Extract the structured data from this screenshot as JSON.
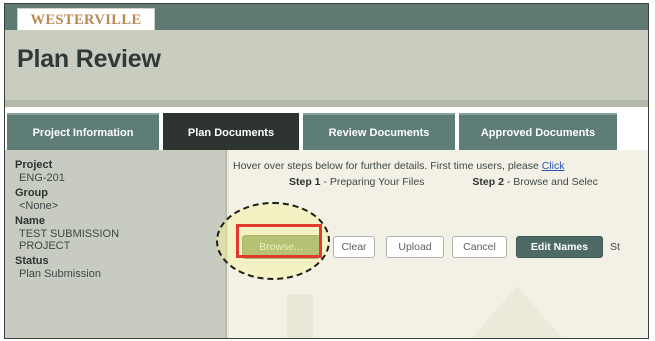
{
  "app": {
    "logo_text": "WESTERVILLE",
    "page_title": "Plan Review"
  },
  "tabs": [
    {
      "label": "Project Information",
      "active": false
    },
    {
      "label": "Plan Documents",
      "active": true
    },
    {
      "label": "Review Documents",
      "active": false
    },
    {
      "label": "Approved Documents",
      "active": false
    }
  ],
  "sidebar": {
    "fields": [
      {
        "label": "Project",
        "value": "ENG-201"
      },
      {
        "label": "Group",
        "value": "<None>"
      },
      {
        "label": "Name",
        "value": "TEST SUBMISSION PROJECT"
      },
      {
        "label": "Status",
        "value": "Plan Submission"
      }
    ]
  },
  "main": {
    "hint_text": "Hover over steps below for further details. First time users, please ",
    "hint_link": "Click",
    "step1_label": "Step 1",
    "step1_text": " - Preparing Your Files",
    "step2_label": "Step 2",
    "step2_text": " - Browse and Selec",
    "trailing_text": "St"
  },
  "toolbar": {
    "browse_label": "Browse...",
    "clear_label": "Clear",
    "upload_label": "Upload",
    "cancel_label": "Cancel",
    "edit_names_label": "Edit Names"
  },
  "colors": {
    "header_bar": "#5f7a73",
    "tab": "#5d7d76",
    "tab_active": "#2d3431",
    "browse_button": "#809a57",
    "highlight_box": "#e03b2f"
  }
}
